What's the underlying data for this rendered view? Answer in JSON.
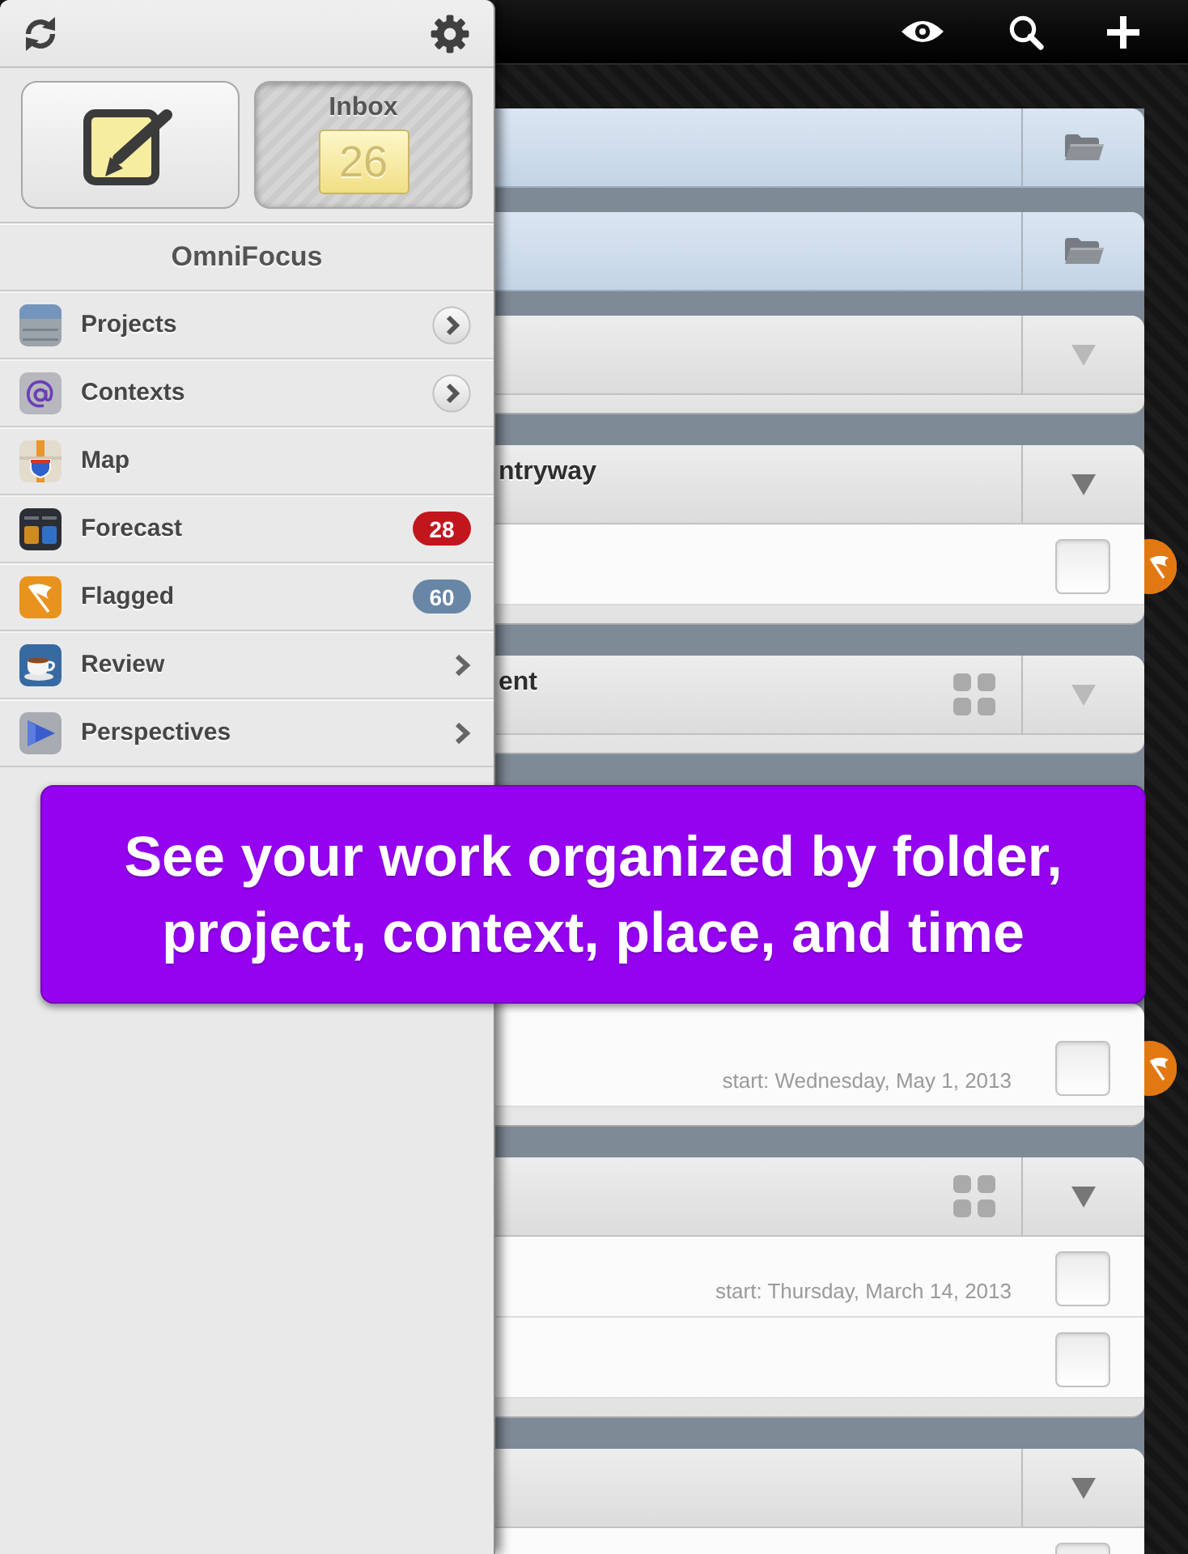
{
  "sidebar": {
    "title": "OmniFocus",
    "inbox": {
      "label": "Inbox",
      "count": "26"
    },
    "items": [
      {
        "label": "Projects",
        "kind": "disclosure",
        "selected": false
      },
      {
        "label": "Contexts",
        "kind": "disclosure",
        "selected": false
      },
      {
        "label": "Map",
        "kind": "plain",
        "selected": false
      },
      {
        "label": "Forecast",
        "kind": "badge",
        "badge": "28",
        "color": "#c2161d",
        "selected": false
      },
      {
        "label": "Flagged",
        "kind": "badge",
        "badge": "60",
        "color": "#6886a6",
        "selected": false
      },
      {
        "label": "Review",
        "kind": "chevron",
        "selected": false
      },
      {
        "label": "Perspectives",
        "kind": "chevron",
        "selected": false
      }
    ]
  },
  "cards": [
    {
      "kind": "folder"
    },
    {
      "kind": "folder"
    },
    {
      "kind": "project",
      "grid": false,
      "dimmed": true
    },
    {
      "kind": "project",
      "title": "ntryway",
      "grid": false,
      "dimmed": false,
      "rows": [
        {
          "checked": false,
          "flagged": true
        }
      ]
    },
    {
      "kind": "project",
      "title": "ent",
      "grid": true,
      "dimmed": true
    },
    {
      "kind": "continued",
      "rows": [
        {
          "start": "start: Wednesday, May 1, 2013",
          "checked": false,
          "flagged": true
        }
      ]
    },
    {
      "kind": "project",
      "grid": true,
      "dimmed": false,
      "rows": [
        {
          "start": "start: Thursday, March 14, 2013",
          "checked": false,
          "flagged": false
        },
        {
          "checked": false,
          "flagged": false
        }
      ]
    },
    {
      "kind": "project",
      "grid": false,
      "dimmed": false,
      "rows": [
        {
          "checked": false,
          "flagged": false
        }
      ]
    }
  ],
  "banner": {
    "text": "See your work organized by folder, project, context, place, and time"
  }
}
